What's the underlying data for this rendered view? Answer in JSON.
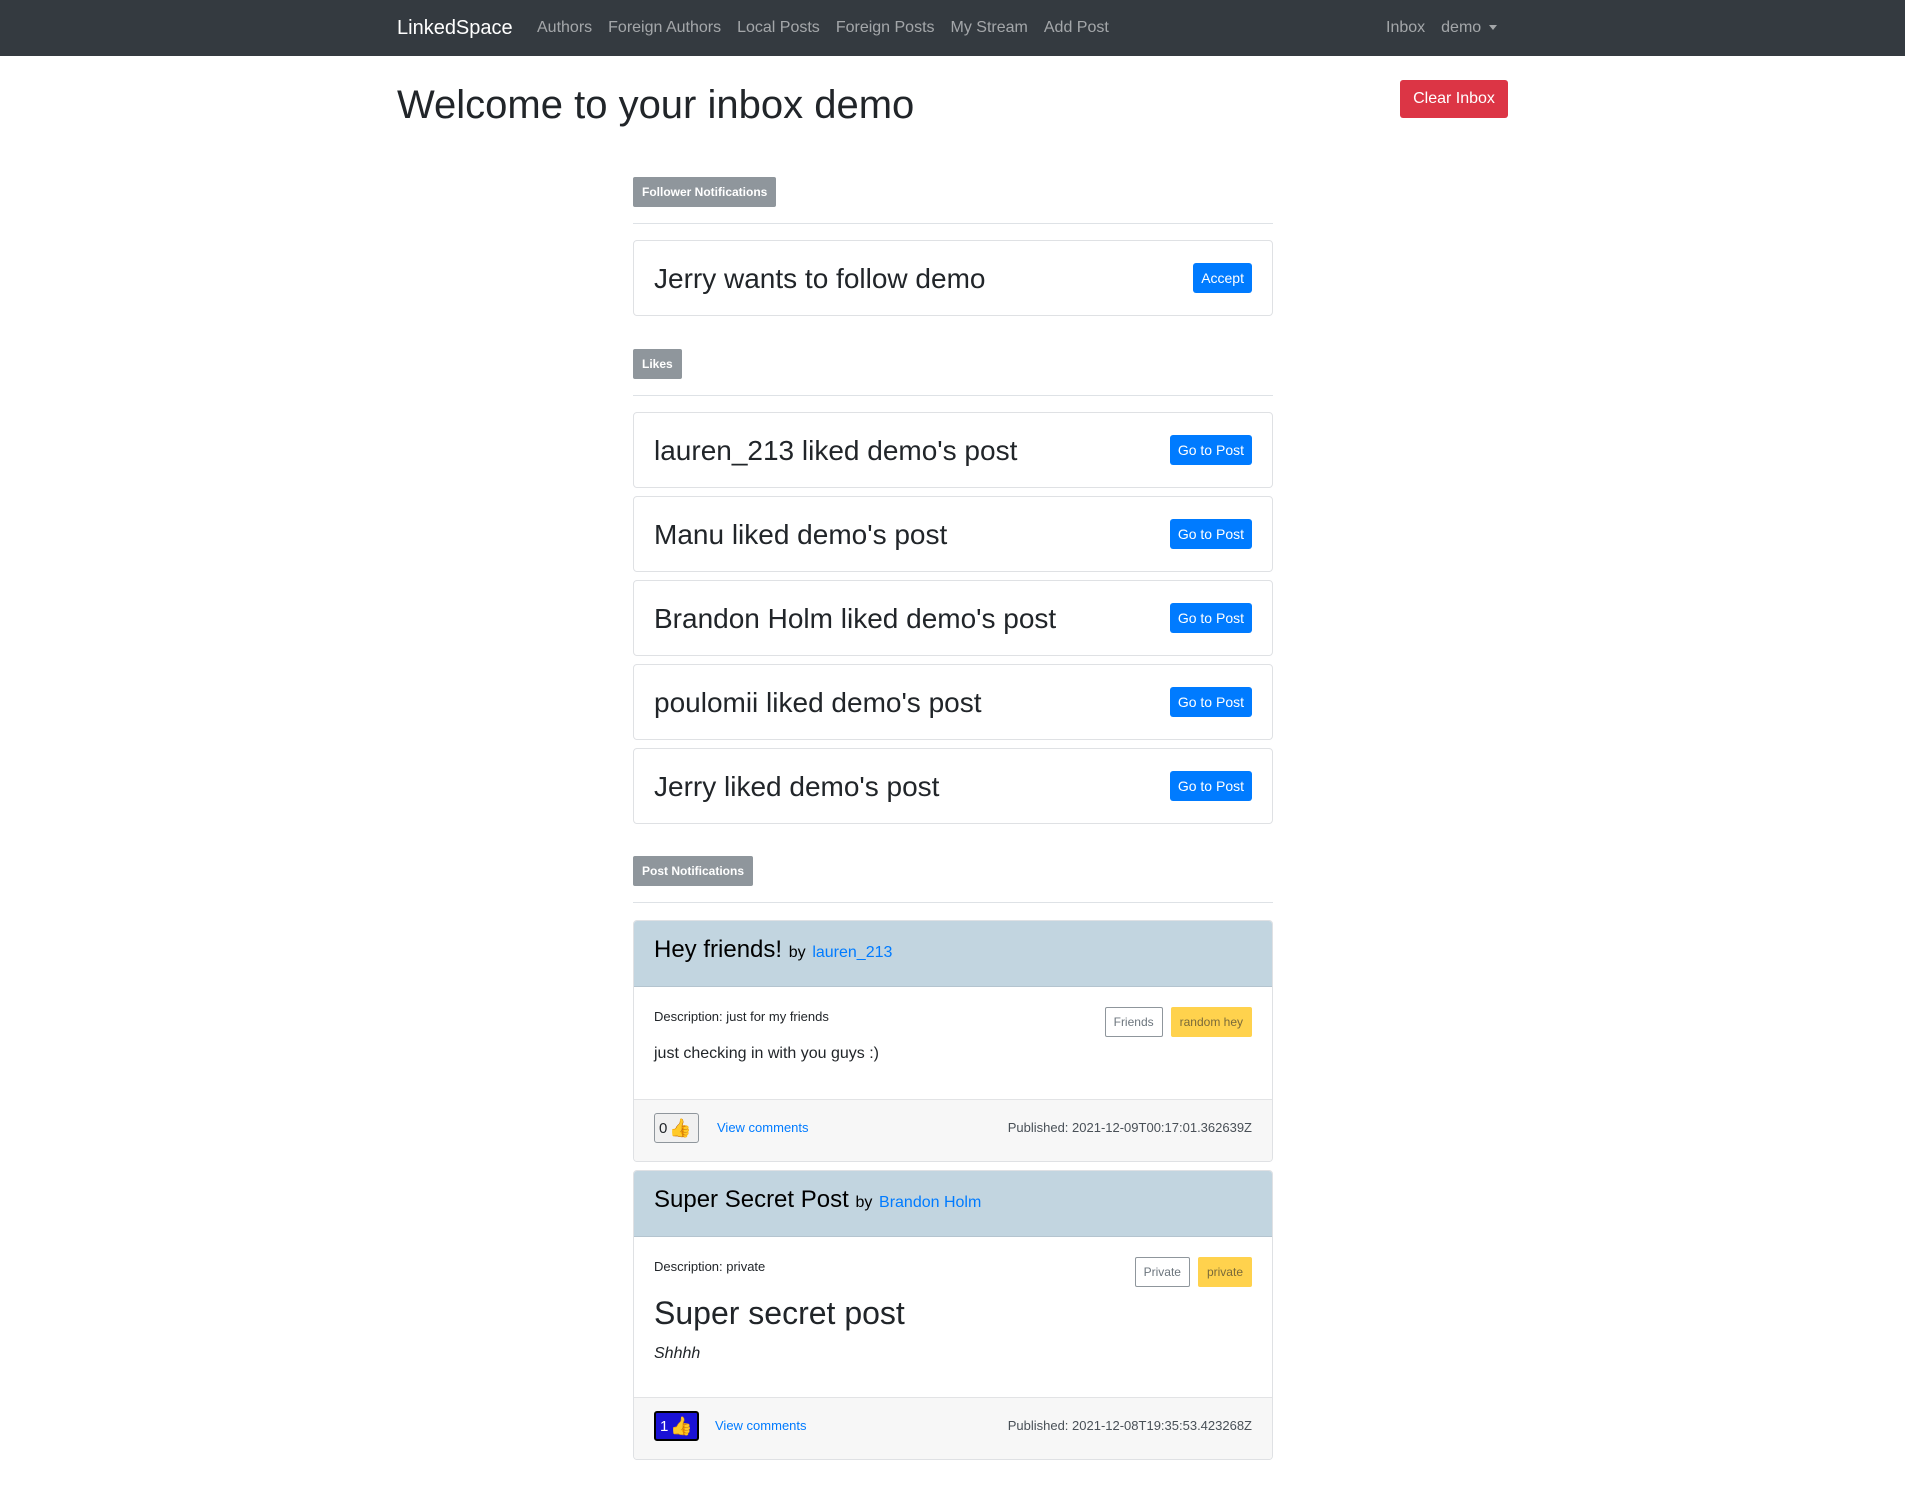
{
  "navbar": {
    "brand": "LinkedSpace",
    "links": [
      "Authors",
      "Foreign Authors",
      "Local Posts",
      "Foreign Posts",
      "My Stream",
      "Add Post"
    ],
    "inbox": "Inbox",
    "user": "demo"
  },
  "header": {
    "title": "Welcome to your inbox demo",
    "clear_button": "Clear Inbox"
  },
  "sections": {
    "follower": "Follower Notifications",
    "likes": "Likes",
    "posts": "Post Notifications"
  },
  "follow_requests": [
    {
      "text": "Jerry wants to follow demo",
      "button": "Accept"
    }
  ],
  "likes": [
    {
      "text": "lauren_213 liked demo's post",
      "button": "Go to Post"
    },
    {
      "text": "Manu liked demo's post",
      "button": "Go to Post"
    },
    {
      "text": "Brandon Holm liked demo's post",
      "button": "Go to Post"
    },
    {
      "text": "poulomii liked demo's post",
      "button": "Go to Post"
    },
    {
      "text": "Jerry liked demo's post",
      "button": "Go to Post"
    }
  ],
  "posts": [
    {
      "title": "Hey friends!",
      "by": "by",
      "author": "lauren_213",
      "description": "Description: just for my friends",
      "tags": [
        "Friends",
        "random hey"
      ],
      "body": "just checking in with you guys :)",
      "likes": "0",
      "thumb_icon": "thumbs-up-icon",
      "view_comments": "View comments",
      "published": "Published: 2021-12-09T00:17:01.362639Z"
    },
    {
      "title": "Super Secret Post",
      "by": "by",
      "author": "Brandon Holm",
      "description": "Description: private",
      "tags": [
        "Private",
        "private"
      ],
      "heading": "Super secret post",
      "body": "Shhhh",
      "likes": "1",
      "thumb_icon": "thumbs-up-icon",
      "view_comments": "View comments",
      "published": "Published: 2021-12-08T19:35:53.423268Z"
    }
  ],
  "colors": {
    "navbar": "#343a40",
    "primary": "#007bff",
    "danger": "#dc3545",
    "badge": "#8f969c",
    "post_header": "#c2d5e0",
    "tag_warning": "#ffd24d",
    "liked": "#1a12d6"
  }
}
